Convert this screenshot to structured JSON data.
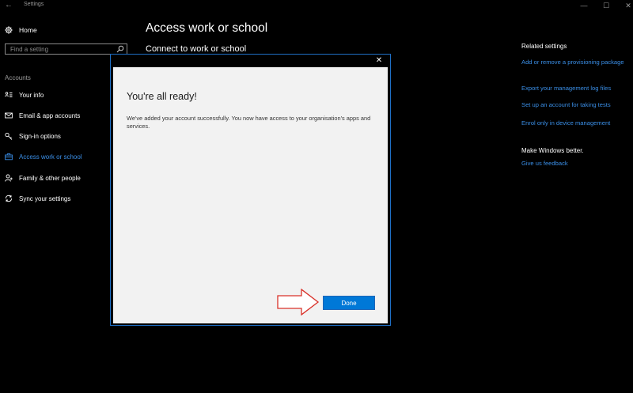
{
  "window": {
    "title": "Settings",
    "back_glyph": "←",
    "minimize_glyph": "—",
    "maximize_glyph": "☐",
    "close_glyph": "✕"
  },
  "sidebar": {
    "home_label": "Home",
    "home_icon": "gear-icon",
    "search_placeholder": "Find a setting",
    "section_label": "Accounts",
    "items": [
      {
        "label": "Your info",
        "icon": "contact-card-icon",
        "active": false
      },
      {
        "label": "Email & app accounts",
        "icon": "mail-icon",
        "active": false
      },
      {
        "label": "Sign-in options",
        "icon": "key-icon",
        "active": false
      },
      {
        "label": "Access work or school",
        "icon": "briefcase-icon",
        "active": true
      },
      {
        "label": "Family & other people",
        "icon": "person-add-icon",
        "active": false
      },
      {
        "label": "Sync your settings",
        "icon": "sync-icon",
        "active": false
      }
    ]
  },
  "main": {
    "title": "Access work or school",
    "subtitle": "Connect to work or school"
  },
  "related": {
    "heading": "Related settings",
    "links": [
      "Add or remove a provisioning package",
      "Export your management log files",
      "Set up an account for taking tests",
      "Enrol only in device management"
    ],
    "better_heading": "Make Windows better.",
    "feedback_link": "Give us feedback"
  },
  "dialog": {
    "close_glyph": "✕",
    "heading": "You're all ready!",
    "message": "We've added your account successfully. You now have access to your organisation's apps and services.",
    "done_label": "Done"
  },
  "colors": {
    "accent": "#0078d7",
    "link": "#3a8ee6",
    "background": "#000000",
    "dialog_body": "#f2f2f2",
    "annotation_arrow": "#d9322a"
  }
}
